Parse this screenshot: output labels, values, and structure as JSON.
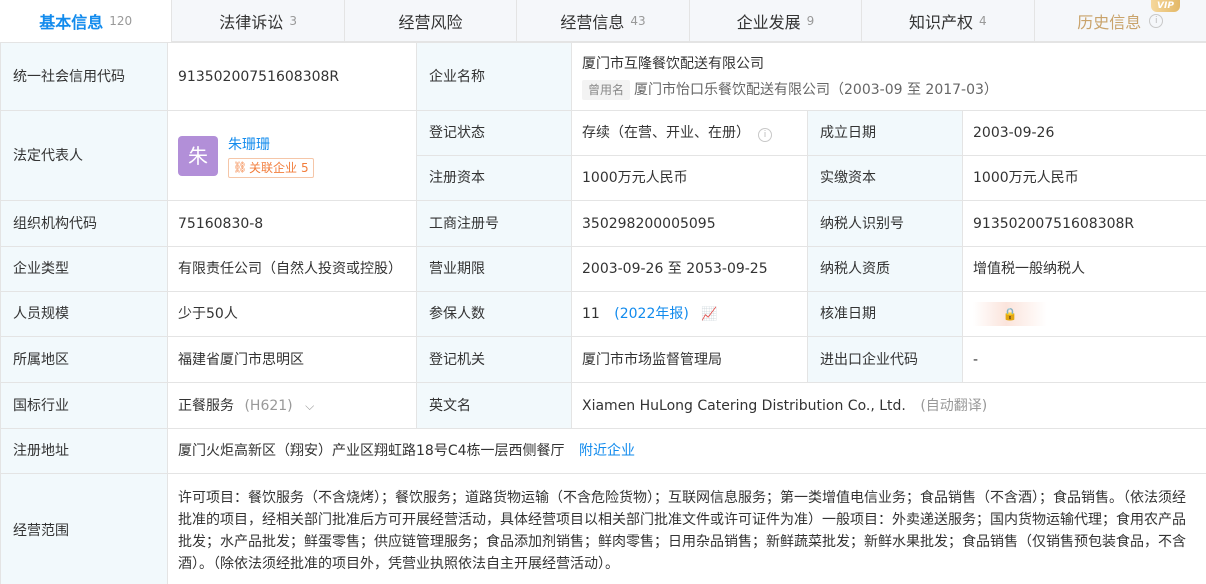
{
  "tabs": [
    {
      "label": "基本信息",
      "count": "120",
      "active": true
    },
    {
      "label": "法律诉讼",
      "count": "3"
    },
    {
      "label": "经营风险",
      "count": ""
    },
    {
      "label": "经营信息",
      "count": "43"
    },
    {
      "label": "企业发展",
      "count": "9"
    },
    {
      "label": "知识产权",
      "count": "4"
    },
    {
      "label": "历史信息",
      "count": "",
      "vip": "VIP"
    }
  ],
  "labels": {
    "credit_code": "统一社会信用代码",
    "company_name": "企业名称",
    "legal_rep": "法定代表人",
    "reg_status": "登记状态",
    "est_date": "成立日期",
    "reg_capital": "注册资本",
    "paid_capital": "实缴资本",
    "org_code": "组织机构代码",
    "biz_reg_no": "工商注册号",
    "taxpayer_id": "纳税人识别号",
    "company_type": "企业类型",
    "biz_term": "营业期限",
    "taxpayer_qual": "纳税人资质",
    "staff_size": "人员规模",
    "insured_count": "参保人数",
    "approval_date": "核准日期",
    "region": "所属地区",
    "reg_authority": "登记机关",
    "ie_code": "进出口企业代码",
    "industry": "国标行业",
    "english_name": "英文名",
    "reg_address": "注册地址",
    "biz_scope": "经营范围"
  },
  "values": {
    "credit_code": "91350200751608308R",
    "company_name": "厦门市互隆餐饮配送有限公司",
    "former_tag": "曾用名",
    "former_name": "厦门市怡口乐餐饮配送有限公司（2003-09 至 2017-03）",
    "legal_avatar": "朱",
    "legal_name": "朱珊珊",
    "related_label": "关联企业",
    "related_count": "5",
    "reg_status": "存续（在营、开业、在册）",
    "est_date": "2003-09-26",
    "reg_capital": "1000万元人民币",
    "paid_capital": "1000万元人民币",
    "org_code": "75160830-8",
    "biz_reg_no": "350298200005095",
    "taxpayer_id": "91350200751608308R",
    "company_type": "有限责任公司（自然人投资或控股）",
    "biz_term": "2003-09-26 至 2053-09-25",
    "taxpayer_qual": "增值税一般纳税人",
    "staff_size": "少于50人",
    "insured_count": "11",
    "insured_report": "(2022年报)",
    "region": "福建省厦门市思明区",
    "reg_authority": "厦门市市场监督管理局",
    "ie_code": "-",
    "industry": "正餐服务",
    "industry_code": "(H621)",
    "english_name": "Xiamen HuLong Catering Distribution Co., Ltd.",
    "auto_translate": "(自动翻译)",
    "reg_address": "厦门火炬高新区（翔安）产业区翔虹路18号C4栋一层西侧餐厅",
    "nearby": "附近企业",
    "biz_scope": "许可项目：餐饮服务（不含烧烤）；餐饮服务；道路货物运输（不含危险货物）；互联网信息服务；第一类增值电信业务；食品销售（不含酒）；食品销售。（依法须经批准的项目，经相关部门批准后方可开展经营活动，具体经营项目以相关部门批准文件或许可证件为准）一般项目：外卖递送服务；国内货物运输代理；食用农产品批发；水产品批发；鲜蛋零售；供应链管理服务；食品添加剂销售；鲜肉零售；日用杂品销售；新鲜蔬菜批发；新鲜水果批发；食品销售（仅销售预包装食品，不含酒）。（除依法须经批准的项目外，凭营业执照依法自主开展经营活动）。"
  },
  "icons": {
    "info": "i",
    "lock": "🔒",
    "chart": "📈",
    "chevron": "⌵",
    "related": "⛓"
  }
}
